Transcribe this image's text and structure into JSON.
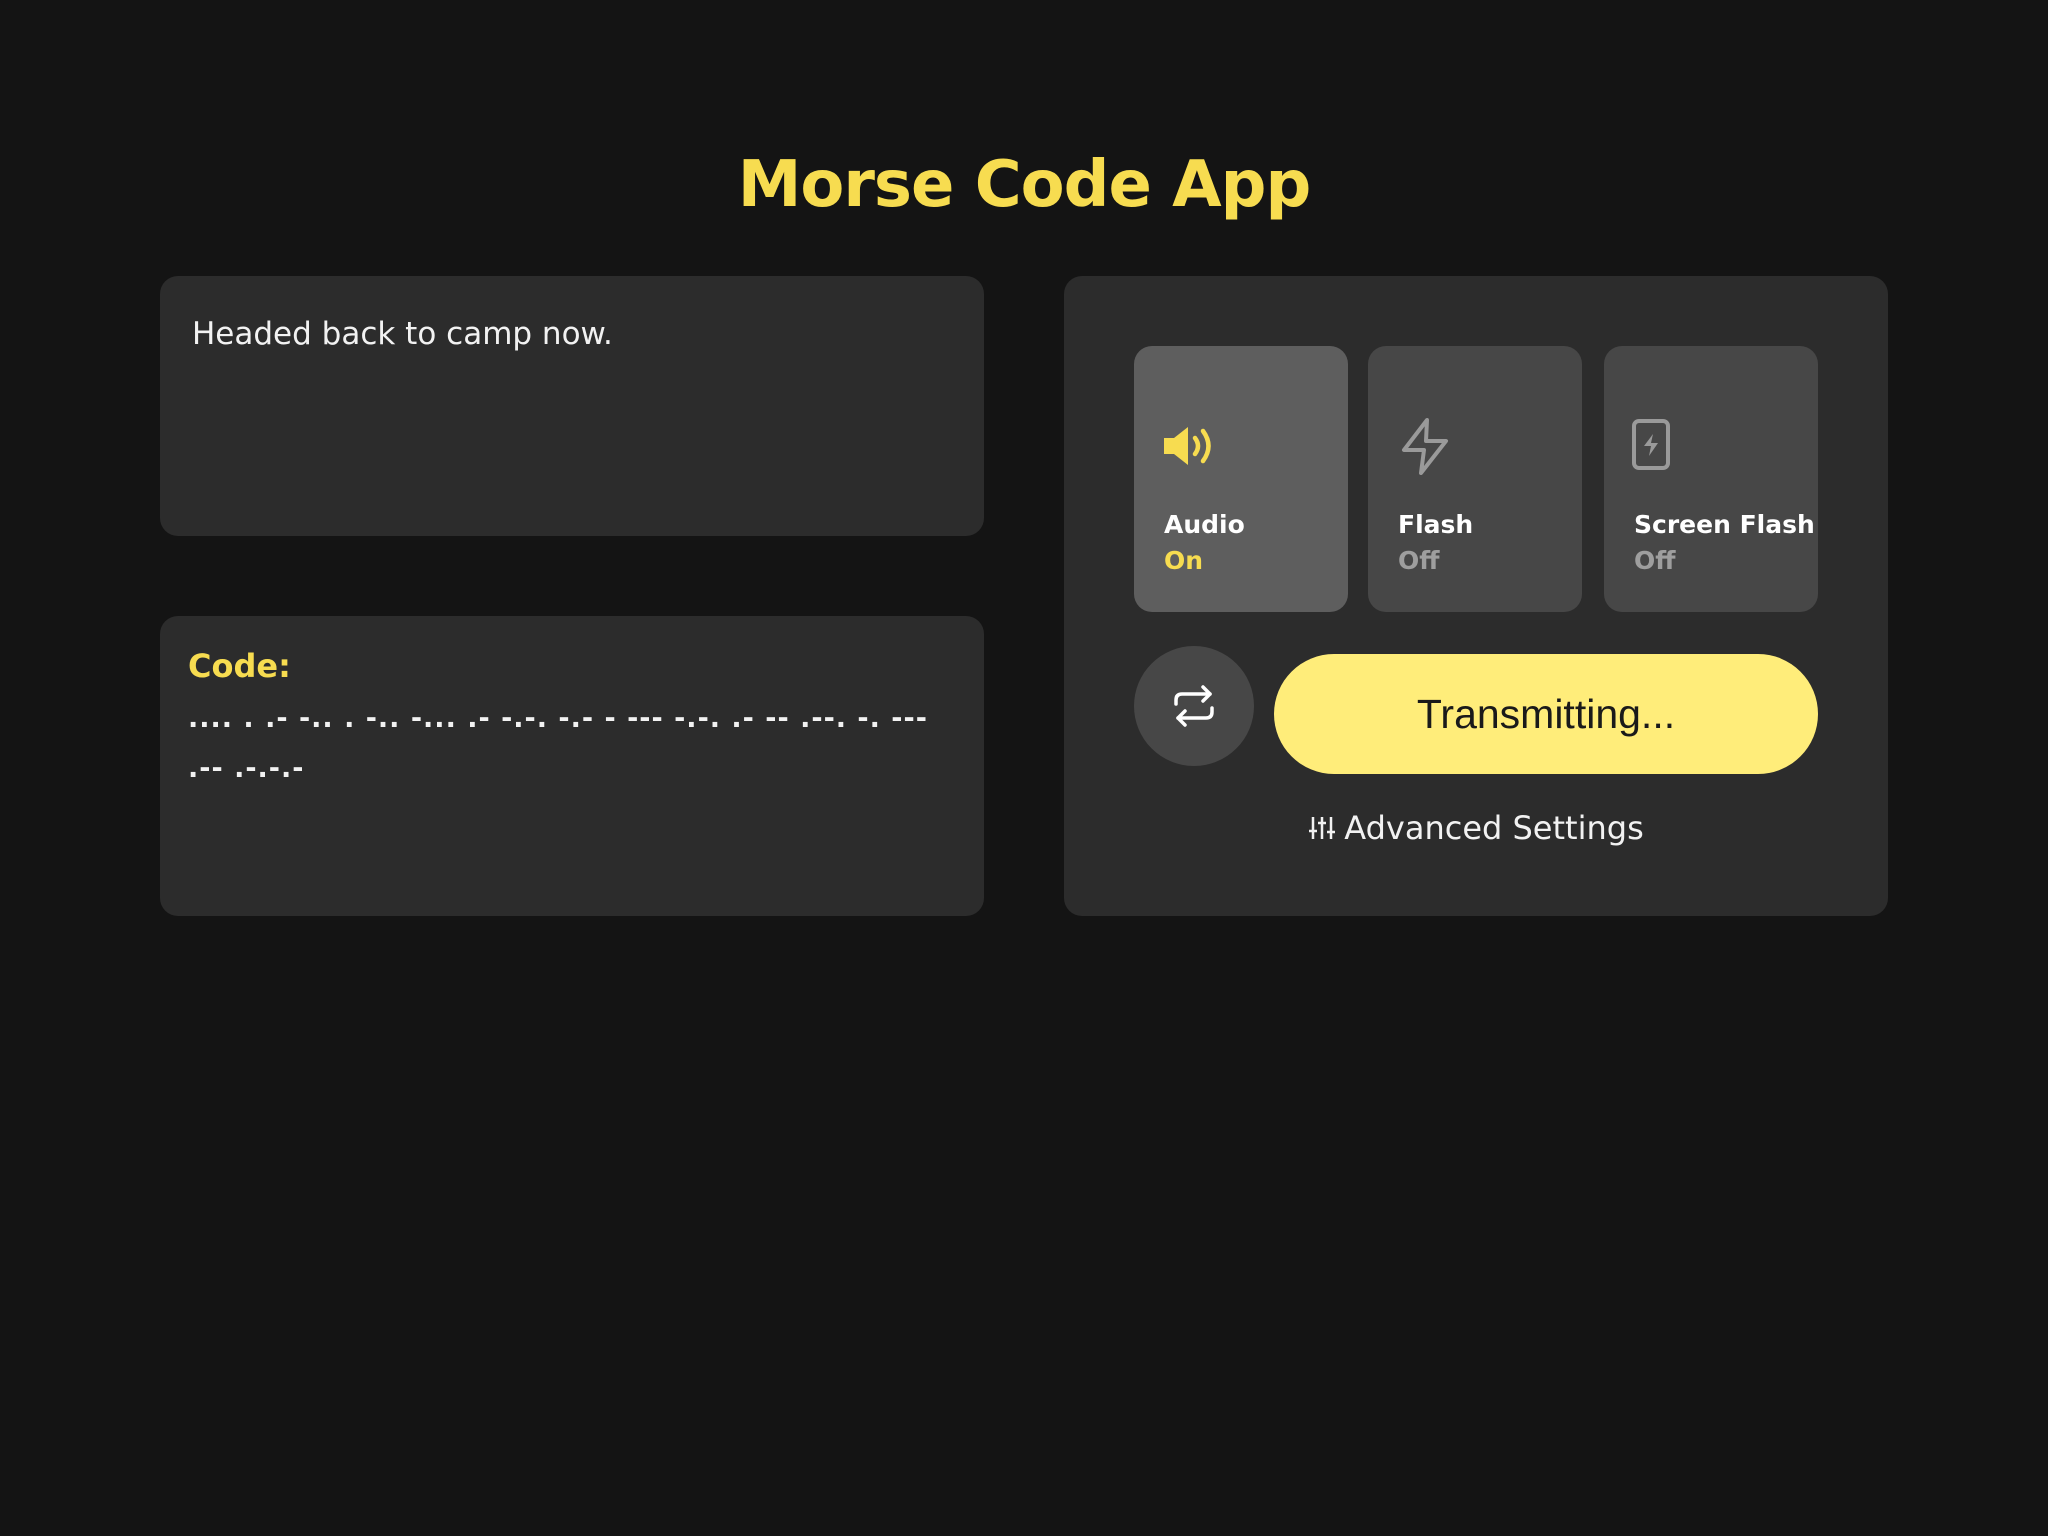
{
  "app": {
    "title": "Morse Code App"
  },
  "input": {
    "text": "Headed back to camp now."
  },
  "output": {
    "label": "Code:",
    "code": ".... . .- -.. . -..   -... .- -.-. -.-   - ---   -.-. .- -- .--.   -. --- .-- .-.-.-"
  },
  "modes": [
    {
      "label": "Audio",
      "state": "On",
      "icon": "speaker-icon",
      "active": true
    },
    {
      "label": "Flash",
      "state": "Off",
      "icon": "lightning-icon",
      "active": false
    },
    {
      "label": "Screen Flash",
      "state": "Off",
      "icon": "phone-flash-icon",
      "active": false
    }
  ],
  "actions": {
    "repeat_icon": "repeat-icon",
    "transmit_label": "Transmitting...",
    "advanced_label": "Advanced Settings",
    "advanced_icon": "sliders-icon"
  },
  "colors": {
    "accent": "#f7dc50",
    "button": "#ffed7a",
    "background": "#141414",
    "card": "#2c2c2c"
  }
}
